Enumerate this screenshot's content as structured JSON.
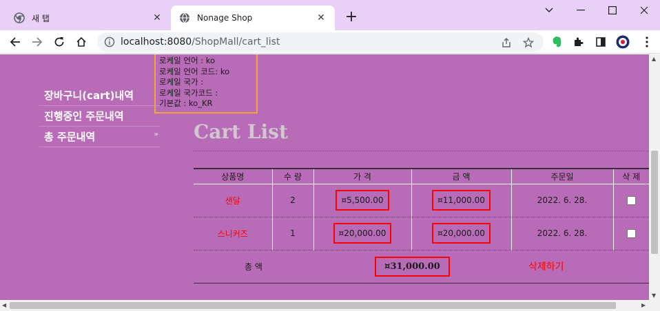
{
  "browser": {
    "tabs": [
      {
        "label": "새 탭",
        "active": false
      },
      {
        "label": "Nonage Shop",
        "active": true
      }
    ],
    "url_host": "localhost:8080",
    "url_path": "/ShopMall/cart_list"
  },
  "locale_info": [
    "로케일 언어 : ko",
    "로케일 언어 코드: ko",
    "로케일 국가 :",
    "로케일 국가코드 :",
    "기본값 : ko_KR"
  ],
  "sidemenu": {
    "items": [
      {
        "label": "장바구니(cart)내역"
      },
      {
        "label": "진행중인 주문내역"
      },
      {
        "label": "총 주문내역"
      }
    ]
  },
  "page_title": "Cart List",
  "cart": {
    "headers": [
      "상품명",
      "수 량",
      "가 격",
      "금 액",
      "주문일",
      "삭 제"
    ],
    "rows": [
      {
        "name": "샌달",
        "qty": "2",
        "price": "¤5,500.00",
        "amount": "¤11,000.00",
        "date": "2022. 6. 28."
      },
      {
        "name": "스니커즈",
        "qty": "1",
        "price": "¤20,000.00",
        "amount": "¤20,000.00",
        "date": "2022. 6. 28."
      }
    ],
    "total_label": "총 액",
    "total_value": "¤31,000.00",
    "delete_label": "삭제하기"
  },
  "colors": {
    "page_bg": "#b86bb7",
    "tabstrip_bg": "#e9d0f7",
    "highlight": "#ff0000",
    "locale_border": "#f3a636"
  }
}
